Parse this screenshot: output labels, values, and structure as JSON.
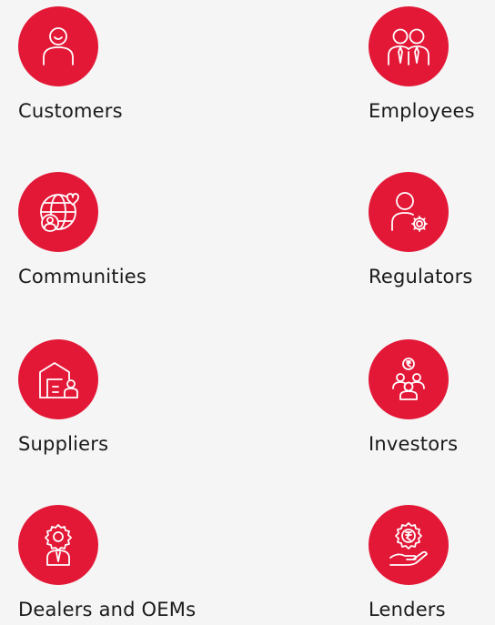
{
  "accent_color": "#e31837",
  "stakeholders": [
    {
      "label": "Customers",
      "icon": "customer-icon"
    },
    {
      "label": "Employees",
      "icon": "employees-icon"
    },
    {
      "label": "Communities",
      "icon": "communities-icon"
    },
    {
      "label": "Regulators",
      "icon": "regulators-icon"
    },
    {
      "label": "Suppliers",
      "icon": "suppliers-icon"
    },
    {
      "label": "Investors",
      "icon": "investors-icon"
    },
    {
      "label": "Dealers and OEMs",
      "icon": "dealers-icon"
    },
    {
      "label": "Lenders",
      "icon": "lenders-icon"
    }
  ]
}
